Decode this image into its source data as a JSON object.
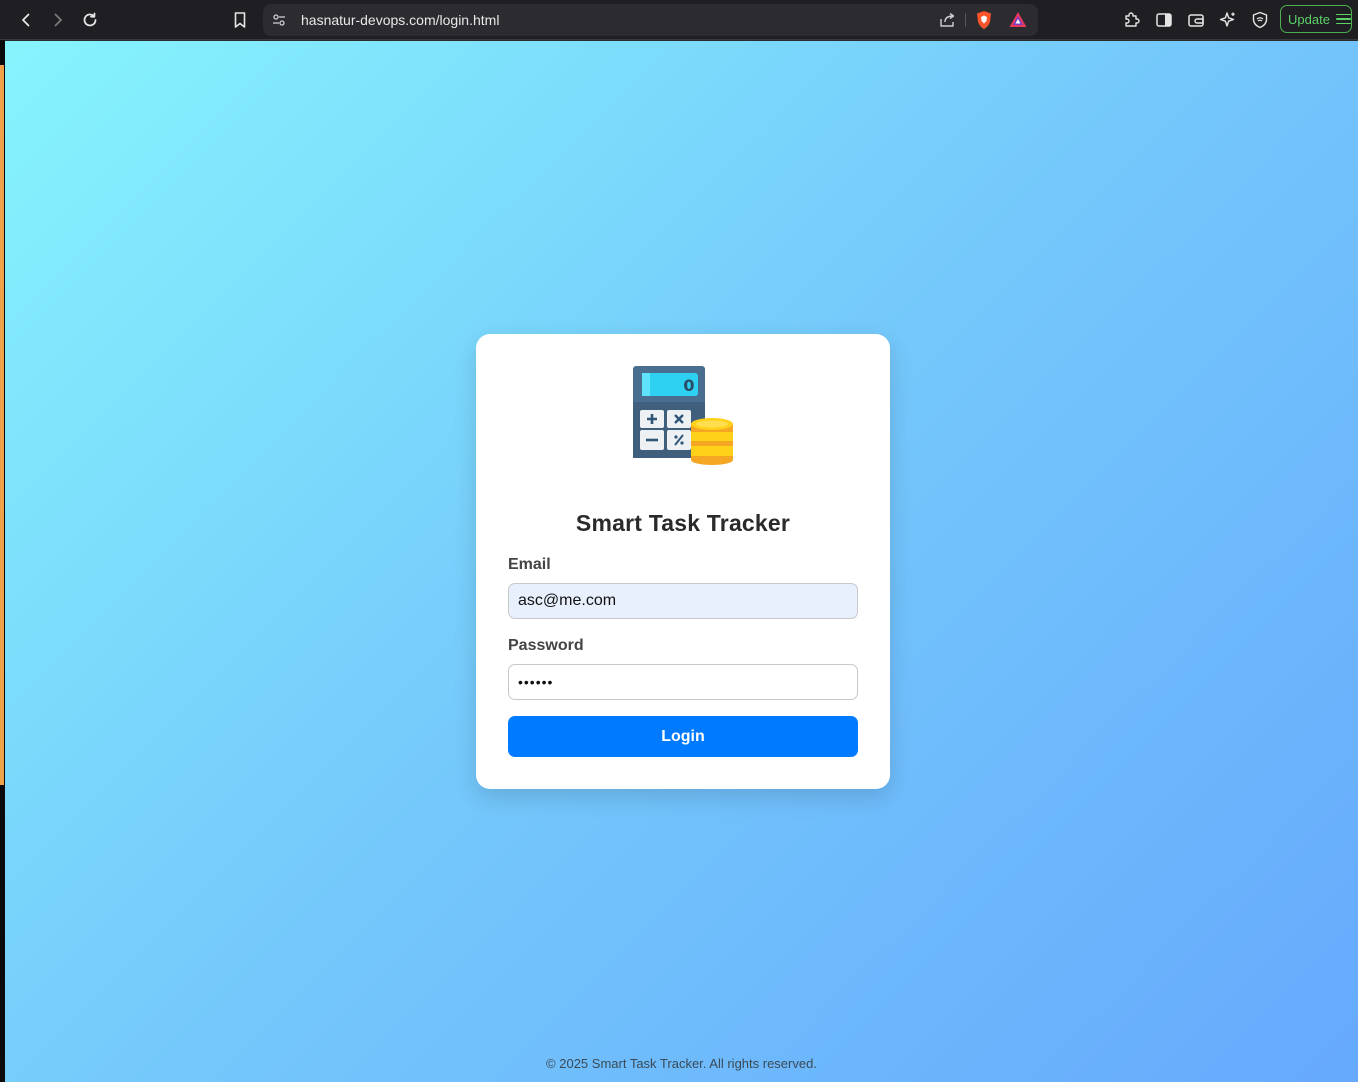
{
  "browser": {
    "url": "hasnatur-devops.com/login.html",
    "update_label": "Update",
    "icons": [
      "back-icon",
      "forward-icon",
      "reload-icon",
      "bookmark-icon",
      "site-info-icon",
      "share-icon",
      "brave-shield-icon",
      "brave-rewards-icon",
      "extensions-icon",
      "sidebar-icon",
      "wallet-icon",
      "leo-ai-icon",
      "vpn-icon",
      "menu-icon"
    ]
  },
  "login": {
    "title": "Smart Task Tracker",
    "email_label": "Email",
    "email_value": "asc@me.com",
    "password_label": "Password",
    "password_value": "••••••",
    "login_button": "Login",
    "logo_icon": "calculator-coins-icon",
    "logo_display": "0"
  },
  "footer": {
    "text": "© 2025 Smart Task Tracker. All rights reserved."
  },
  "colors": {
    "button": "#007bff",
    "gradient_start": "#86f4fd",
    "gradient_end": "#66a9fd",
    "update_green": "#5bd167"
  }
}
